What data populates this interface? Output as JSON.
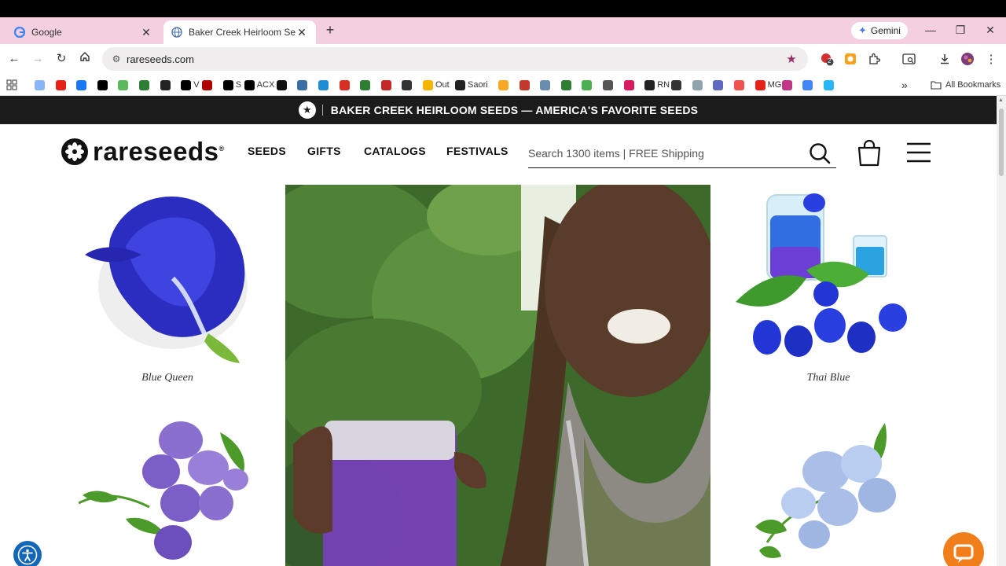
{
  "browser": {
    "tabs": [
      {
        "title": "Google",
        "close": "✕"
      },
      {
        "title": "Baker Creek Heirloom Seeds, Bu",
        "close": "✕"
      }
    ],
    "new_tab": "+",
    "gemini_label": "Gemini",
    "url": "rareseeds.com",
    "extension_badge": "2",
    "bookmarks": [
      {
        "label": "",
        "color": "#8ab4f8"
      },
      {
        "label": "",
        "color": "#e62117"
      },
      {
        "label": "",
        "color": "#1877f2"
      },
      {
        "label": "",
        "color": "#000000"
      },
      {
        "label": "",
        "color": "#5cb85c"
      },
      {
        "label": "",
        "color": "#2e7d32"
      },
      {
        "label": "",
        "color": "#222222"
      },
      {
        "label": "V",
        "color": "#000000"
      },
      {
        "label": "",
        "color": "#b00000"
      },
      {
        "label": "S",
        "color": "#000000"
      },
      {
        "label": "ACX",
        "color": "#000000"
      },
      {
        "label": "",
        "color": "#111111"
      },
      {
        "label": "",
        "color": "#3a6ea5"
      },
      {
        "label": "",
        "color": "#1f8dd6"
      },
      {
        "label": "",
        "color": "#d93025"
      },
      {
        "label": "",
        "color": "#2e7d32"
      },
      {
        "label": "",
        "color": "#c62828"
      },
      {
        "label": "",
        "color": "#333333"
      },
      {
        "label": "Out",
        "color": "#f4b400"
      },
      {
        "label": "Saori",
        "color": "#222222"
      },
      {
        "label": "",
        "color": "#f9a825"
      },
      {
        "label": "",
        "color": "#c0392b"
      },
      {
        "label": "",
        "color": "#6a8caf"
      },
      {
        "label": "",
        "color": "#2e7d32"
      },
      {
        "label": "",
        "color": "#4caf50"
      },
      {
        "label": "",
        "color": "#555555"
      },
      {
        "label": "",
        "color": "#d81b60"
      },
      {
        "label": "RN",
        "color": "#222222"
      },
      {
        "label": "",
        "color": "#333333"
      },
      {
        "label": "",
        "color": "#90a4ae"
      },
      {
        "label": "",
        "color": "#5c6bc0"
      },
      {
        "label": "",
        "color": "#ef5350"
      },
      {
        "label": "MG",
        "color": "#e62117"
      },
      {
        "label": "",
        "color": "#c13584"
      },
      {
        "label": "",
        "color": "#4285f4"
      },
      {
        "label": "",
        "color": "#29b6f6"
      }
    ],
    "bookmarks_more": "»",
    "all_bookmarks": "All Bookmarks"
  },
  "site": {
    "announcement": "BAKER CREEK HEIRLOOM SEEDS — AMERICA'S FAVORITE SEEDS",
    "logo_text": "rareseeds",
    "logo_reg": "®",
    "nav": [
      "SEEDS",
      "GIFTS",
      "CATALOGS",
      "FESTIVALS"
    ],
    "search_placeholder": "Search 1300 items | FREE Shipping",
    "products": [
      {
        "name": "Blue Queen",
        "color": "#2e2fc9"
      },
      {
        "name": "Thai Blue",
        "color": "#2336d6"
      },
      {
        "name": "",
        "color": "#8b6fd0"
      },
      {
        "name": "",
        "color": "#a9bfe8"
      }
    ]
  },
  "colors": {
    "tabstrip": "#f3cfe0",
    "announce_bg": "#1b1b1b",
    "accessibility": "#1267b8",
    "chat": "#f07e1a"
  }
}
